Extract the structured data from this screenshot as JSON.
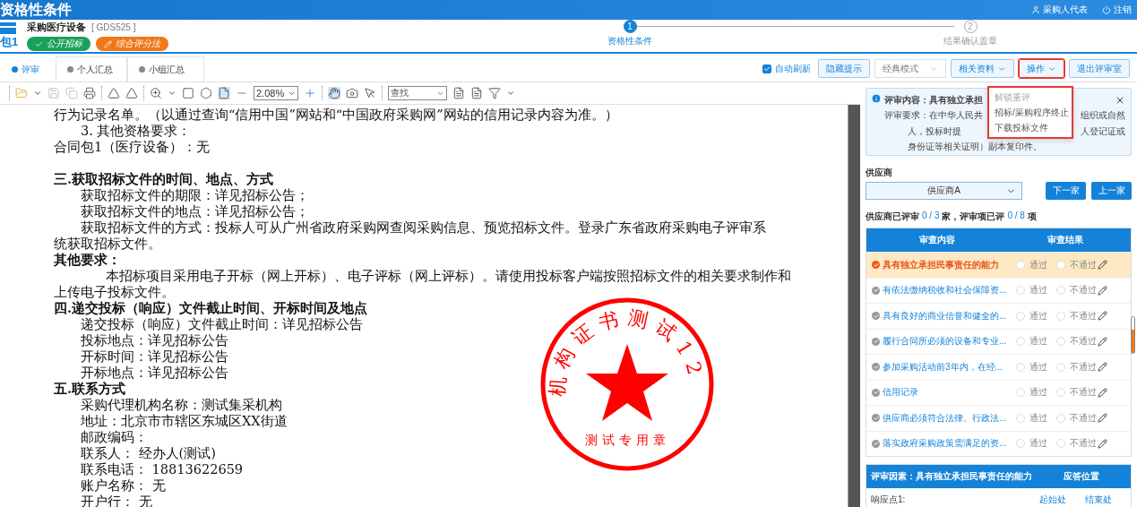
{
  "header": {
    "title": "资格性条件",
    "user": "采购人代表",
    "logout": "注销"
  },
  "project": {
    "package": "包1",
    "name": "采购医疗设备",
    "code": "[ GDS525 ]",
    "badges": [
      {
        "label": "公开招标",
        "color": "#1aa05a"
      },
      {
        "label": "综合评分法",
        "color": "#f07818"
      }
    ]
  },
  "steps": [
    {
      "number": "1",
      "label": "资格性条件",
      "selected": true
    },
    {
      "number": "2",
      "label": "结果确认盖章",
      "selected": false
    }
  ],
  "tabs": [
    {
      "label": "评审",
      "selected": true
    },
    {
      "label": "个人汇总",
      "selected": false
    },
    {
      "label": "小组汇总",
      "selected": false
    }
  ],
  "actions": {
    "auto_refresh": {
      "label": "自动刷新",
      "checked": true
    },
    "hide_tips": "隐藏提示",
    "mode": "经典模式",
    "materials": "相关资料",
    "operations": {
      "label": "操作",
      "highlighted": true
    },
    "exit": "退出评审室"
  },
  "menu": {
    "highlighted": true,
    "items": [
      {
        "label": "解锁重评",
        "disabled": true
      },
      {
        "label": "招标/采购程序终止",
        "disabled": false
      },
      {
        "label": "下载投标文件",
        "disabled": false
      }
    ]
  },
  "viewer": {
    "zoom": "2.08%",
    "find": "查找"
  },
  "document": {
    "lines": [
      {
        "kind": "plain",
        "text": "行为记录名单。（以通过查询“信用中国”网站和“中国政府采购网”网站的信用记录内容为准。）"
      },
      {
        "kind": "indented",
        "text": "3. 其他资格要求："
      },
      {
        "kind": "plain",
        "text": "合同包1（医疗设备）：无"
      },
      {
        "kind": "heading",
        "space_before": true,
        "text": "三.获取招标文件的时间、地点、方式"
      },
      {
        "kind": "indented",
        "text": "获取招标文件的期限：详见招标公告；"
      },
      {
        "kind": "indented",
        "text": "获取招标文件的地点：详见招标公告；"
      },
      {
        "kind": "indented",
        "text": "获取招标文件的方式：投标人可从广州省政府采购网查阅采购信息、预览招标文件。登录广东省政府采购电子评审系"
      },
      {
        "kind": "plain",
        "text": "统获取招标文件。"
      },
      {
        "kind": "heading",
        "text": "其他要求："
      },
      {
        "kind": "para",
        "text": "本招标项目采用电子开标（网上开标）、电子评标（网上评标）。请使用投标客户端按照招标文件的相关要求制作和"
      },
      {
        "kind": "plain",
        "text": "上传电子投标文件。"
      },
      {
        "kind": "heading",
        "text": "四.递交投标（响应）文件截止时间、开标时间及地点"
      },
      {
        "kind": "indented",
        "text": "递交投标（响应）文件截止时间：详见招标公告"
      },
      {
        "kind": "indented",
        "text": "投标地点：详见招标公告"
      },
      {
        "kind": "indented",
        "text": "开标时间：详见招标公告"
      },
      {
        "kind": "indented",
        "text": "开标地点：详见招标公告"
      },
      {
        "kind": "heading",
        "text": "五.联系方式"
      },
      {
        "kind": "indented",
        "text": "采购代理机构名称：测试集采机构"
      },
      {
        "kind": "indented",
        "text": "地址：北京市市辖区东城区XX街道"
      },
      {
        "kind": "indented",
        "text": "邮政编码："
      },
      {
        "kind": "indented",
        "text": "联系人： 经办人(测试)"
      },
      {
        "kind": "indented",
        "text": "联系电话： 18813622659"
      },
      {
        "kind": "indented",
        "text": "账户名称： 无"
      },
      {
        "kind": "indented",
        "text": "开户行： 无"
      }
    ],
    "seal": {
      "ring_text": "机构证书测试12",
      "center_text": "测试专用章"
    }
  },
  "info": {
    "rows": [
      {
        "left": "评审内容：具有独立承担",
        "right": ""
      },
      {
        "left": "评审要求：在中华人民共",
        "right": "组织或自然"
      },
      {
        "left": "人，投标时提",
        "right": "人登记证或"
      },
      {
        "left": "身份证等相关证明）副本复印件。",
        "right": ""
      }
    ]
  },
  "supplier": {
    "label": "供应商",
    "selected": "供应商A",
    "next": "下一家",
    "prev": "上一家"
  },
  "progress": {
    "prefix": "供应商已评审",
    "suppliers": "0 / 3",
    "middle": "家，评审项已评",
    "items": "0 / 8",
    "suffix": "项"
  },
  "review_table": {
    "columns": [
      "审查内容",
      "审查结果"
    ],
    "rows": [
      {
        "name": "具有独立承担民事责任的能力",
        "selected": true,
        "pass": "通过",
        "fail": "不通过",
        "pass_checked": false,
        "fail_checked": false
      },
      {
        "name": "有依法缴纳税收和社会保障资...",
        "selected": false,
        "pass": "通过",
        "fail": "不通过",
        "pass_checked": false,
        "fail_checked": false
      },
      {
        "name": "具有良好的商业信誉和健全的...",
        "selected": false,
        "pass": "通过",
        "fail": "不通过",
        "pass_checked": false,
        "fail_checked": false
      },
      {
        "name": "履行合同所必须的设备和专业...",
        "selected": false,
        "pass": "通过",
        "fail": "不通过",
        "pass_checked": false,
        "fail_checked": false
      },
      {
        "name": "参加采购活动前3年内，在经...",
        "selected": false,
        "pass": "通过",
        "fail": "不通过",
        "pass_checked": false,
        "fail_checked": false
      },
      {
        "name": "信用记录",
        "selected": false,
        "pass": "通过",
        "fail": "不通过",
        "pass_checked": false,
        "fail_checked": false
      },
      {
        "name": "供应商必须符合法律、行政法...",
        "selected": false,
        "pass": "通过",
        "fail": "不通过",
        "pass_checked": false,
        "fail_checked": false
      },
      {
        "name": "落实政府采购政策需满足的资...",
        "selected": false,
        "pass": "通过",
        "fail": "不通过",
        "pass_checked": false,
        "fail_checked": false
      }
    ]
  },
  "factor_table": {
    "columns": [
      "评审因素：具有独立承担民事责任的能力",
      "应答位置"
    ],
    "rows": [
      {
        "label": "响应点1:",
        "start": "起始处",
        "end": "结束处"
      }
    ]
  }
}
